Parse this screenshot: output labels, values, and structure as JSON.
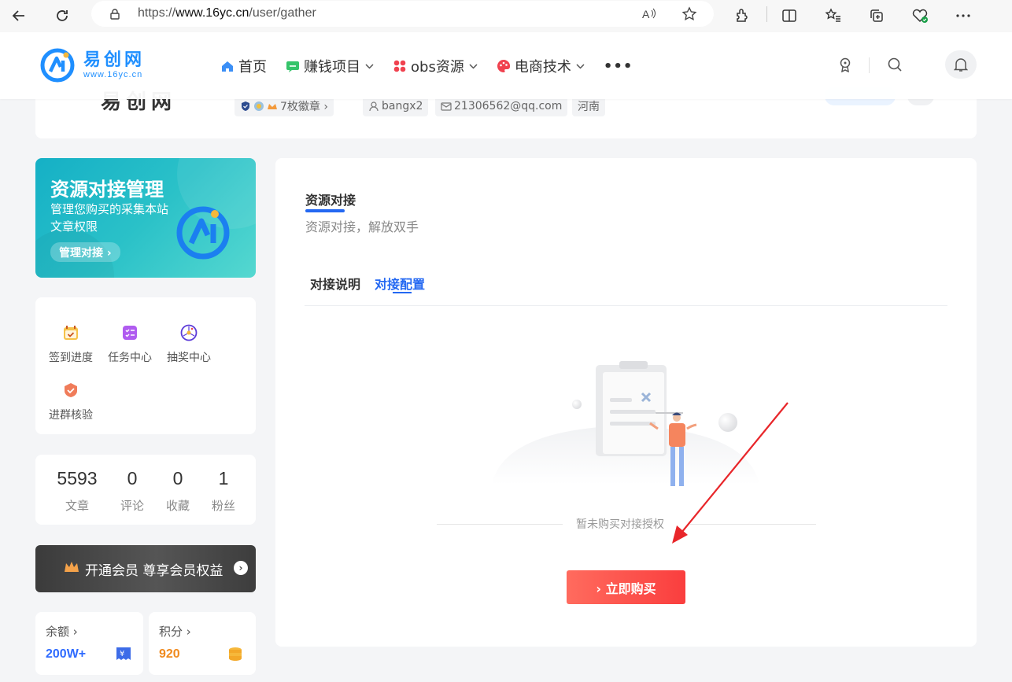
{
  "browser": {
    "url_prefix": "https://",
    "url_domain": "www.16yc.cn",
    "url_path": "/user/gather"
  },
  "site": {
    "logo_cn": "易创网",
    "logo_url": "www.16yc.cn",
    "nav": [
      {
        "label": "首页",
        "icon": "home-icon",
        "color": "#3b8ff6"
      },
      {
        "label": "赚钱项目",
        "icon": "chat-money-icon",
        "color": "#35c46a"
      },
      {
        "label": "obs资源",
        "icon": "grid-dots-icon",
        "color": "#f0424f"
      },
      {
        "label": "电商技术",
        "icon": "palette-icon",
        "color": "#f0424f"
      }
    ],
    "nav_more": "•••"
  },
  "profile": {
    "name_partial": "易创网",
    "badges_label": "7枚徽章 ›",
    "username": "bangx2",
    "email": "21306562@qq.com",
    "region": "河南"
  },
  "banner": {
    "title": "资源对接管理",
    "subtitle": "管理您购买的采集本站文章权限",
    "button": "管理对接 ›"
  },
  "quick_links": [
    {
      "label": "签到进度",
      "icon": "calendar-check-icon"
    },
    {
      "label": "任务中心",
      "icon": "task-list-icon"
    },
    {
      "label": "抽奖中心",
      "icon": "lottery-wheel-icon"
    },
    {
      "label": "进群核验",
      "icon": "group-verify-icon"
    }
  ],
  "stats": [
    {
      "value": "5593",
      "label": "文章"
    },
    {
      "value": "0",
      "label": "评论"
    },
    {
      "value": "0",
      "label": "收藏"
    },
    {
      "value": "1",
      "label": "粉丝"
    }
  ],
  "vip": {
    "text": "开通会员 尊享会员权益"
  },
  "wallet": {
    "balance_label": "余额 ›",
    "balance_value": "200W+",
    "points_label": "积分 ›",
    "points_value": "920"
  },
  "main": {
    "title": "资源对接",
    "subtitle": "资源对接，解放双手",
    "tabs": [
      {
        "label": "对接说明",
        "active": false
      },
      {
        "label": "对接配置",
        "active": true
      }
    ],
    "empty_text": "暂未购买对接授权",
    "buy_button": "› 立即购买"
  },
  "colors": {
    "accent": "#2468f2",
    "buy_gradient_start": "#ff6b5e",
    "buy_gradient_end": "#fa3e3e",
    "balance_color": "#2f6bff",
    "points_color": "#f08a1d"
  }
}
